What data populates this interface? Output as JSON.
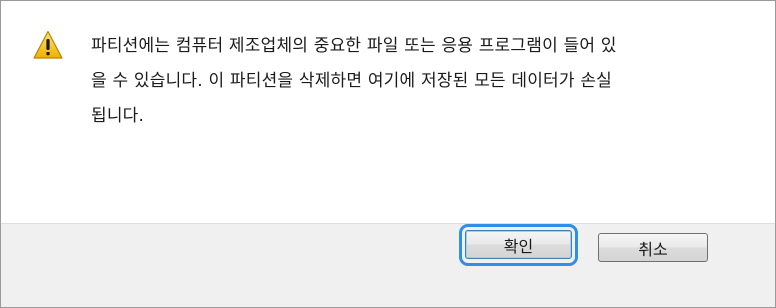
{
  "dialog": {
    "message_lines": [
      "파티션에는 컴퓨터 제조업체의 중요한 파일 또는 응용 프로그램이 들어 있",
      "을 수 있습니다. 이 파티션을 삭제하면 여기에 저장된 모든 데이터가 손실",
      "됩니다."
    ],
    "icon": "warning-icon",
    "buttons": {
      "ok_label": "확인",
      "cancel_label": "취소"
    }
  },
  "colors": {
    "focus_ring": "#2f8fe8",
    "warning_fill": "#f7c21c",
    "footer_bg": "#f0f0f0"
  }
}
